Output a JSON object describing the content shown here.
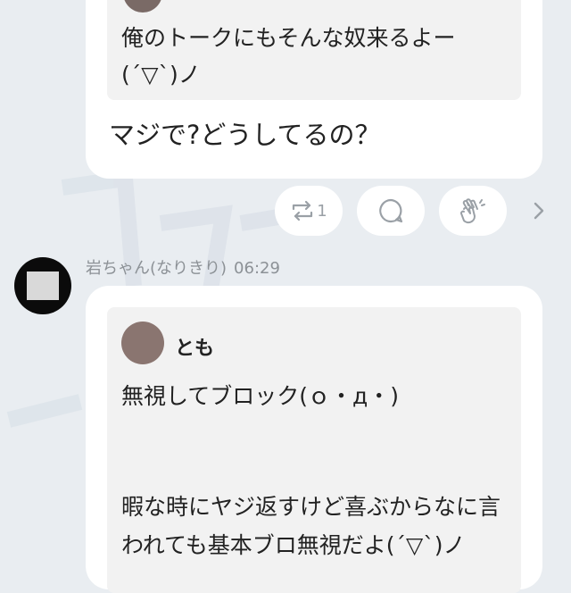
{
  "messages": [
    {
      "quote": {
        "text": "俺のトークにもそんな奴来るよー\n(´▽`)ノ"
      },
      "text": "マジで?どうしてるの？",
      "reactions": {
        "repost_count": "1",
        "icons": [
          "repost-icon",
          "comment-icon",
          "clap-icon",
          "chevron-right-icon"
        ]
      }
    },
    {
      "author": "岩ちゃん(なりきり)",
      "time": "06:29",
      "quote": {
        "author": "とも",
        "line1": "無視してブロック(ｏ・д・)",
        "line2": "暇な時にヤジ返すけど喜ぶからなに言われても基本ブロ無視だよ(´▽`)ノ"
      }
    }
  ],
  "colors": {
    "background": "#e9edf1",
    "bubble": "#ffffff",
    "quote_bg": "#f2f2f2",
    "muted_text": "#8c9196"
  }
}
